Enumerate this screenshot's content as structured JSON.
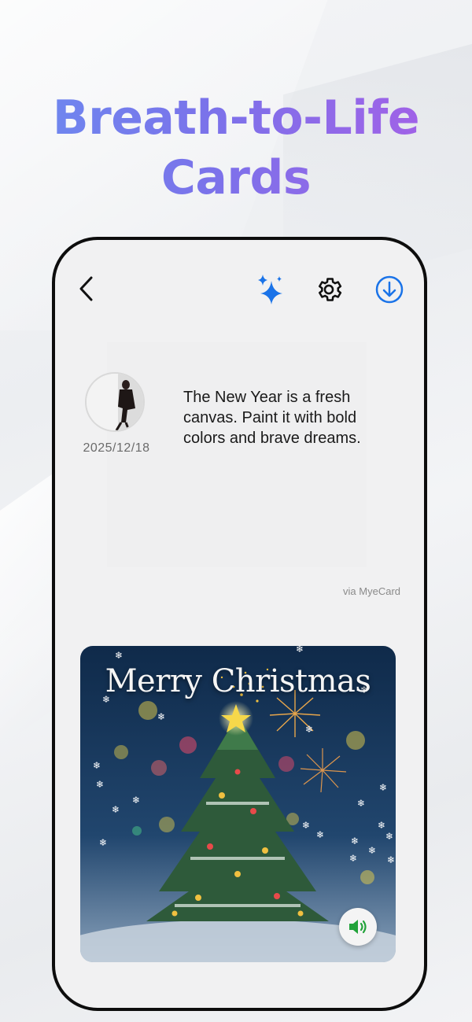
{
  "headline": {
    "line1": "Breath-to-Life",
    "line2": "Cards"
  },
  "toolbar": {
    "back_icon": "chevron-left-icon",
    "sparkle_icon": "sparkle-icon",
    "settings_icon": "gear-icon",
    "download_icon": "download-icon",
    "accent_color": "#1a73e8"
  },
  "message": {
    "date": "2025/12/18",
    "text": "The New Year is a fresh canvas. Paint it with bold colors and brave dreams.",
    "via": "via MyeCard"
  },
  "card": {
    "title": "Merry Christmas",
    "sound_icon": "speaker-icon",
    "sound_color": "#22a33a"
  }
}
